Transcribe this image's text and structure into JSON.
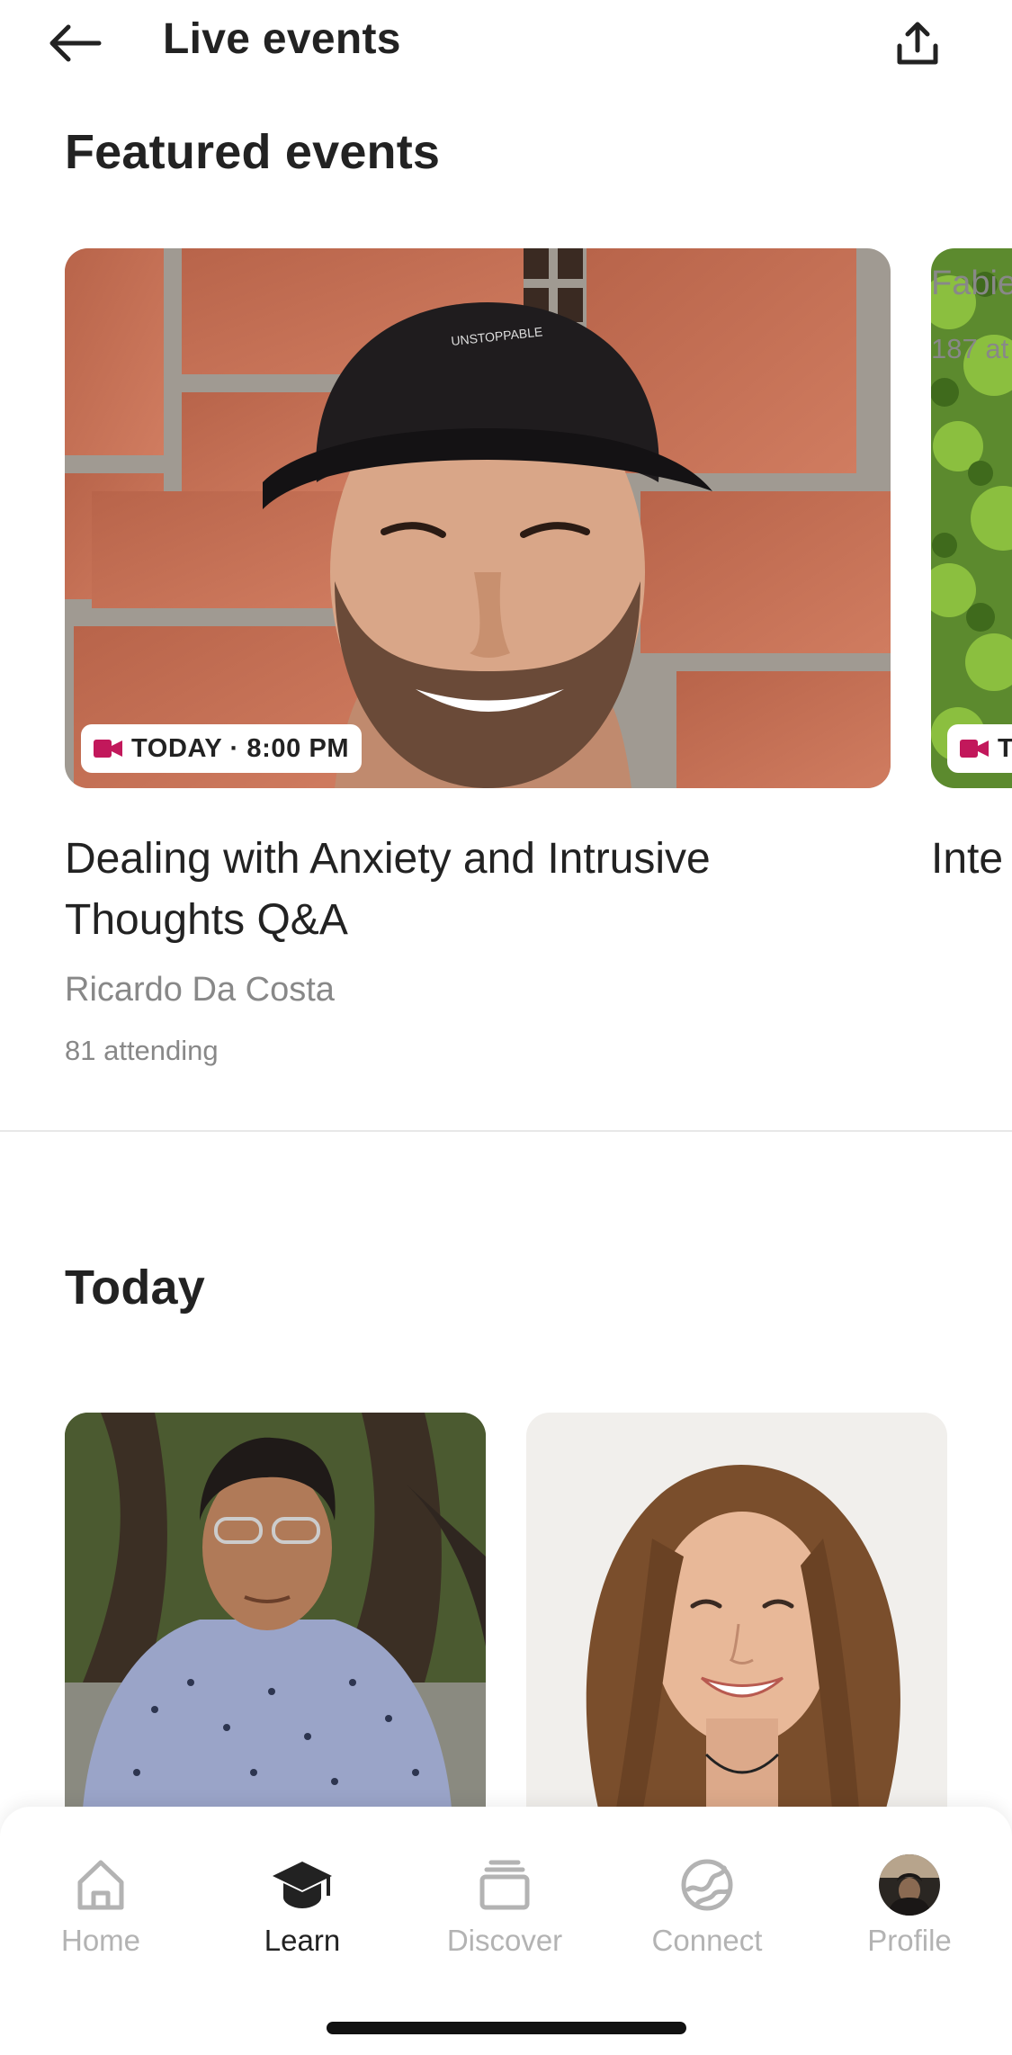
{
  "header": {
    "title": "Live events"
  },
  "featured": {
    "section_title": "Featured events",
    "cards": [
      {
        "badge": "TODAY · 8:00 PM",
        "title": "Dealing with Anxiety and Intrusive Thoughts Q&A",
        "host": "Ricardo Da Costa",
        "attending": "81 attending"
      },
      {
        "badge": "T",
        "title": "Inte",
        "host": "Fabie",
        "attending": "187 at"
      }
    ]
  },
  "today": {
    "section_title": "Today"
  },
  "tabbar": {
    "items": [
      {
        "label": "Home",
        "icon": "home-icon"
      },
      {
        "label": "Learn",
        "icon": "graduation-cap-icon",
        "active": true
      },
      {
        "label": "Discover",
        "icon": "stack-icon"
      },
      {
        "label": "Connect",
        "icon": "globe-icon"
      },
      {
        "label": "Profile",
        "icon": "avatar"
      }
    ]
  },
  "colors": {
    "accent": "#c2185b",
    "text": "#222222",
    "muted": "#888888",
    "tab_inactive": "#b3b3b3"
  }
}
